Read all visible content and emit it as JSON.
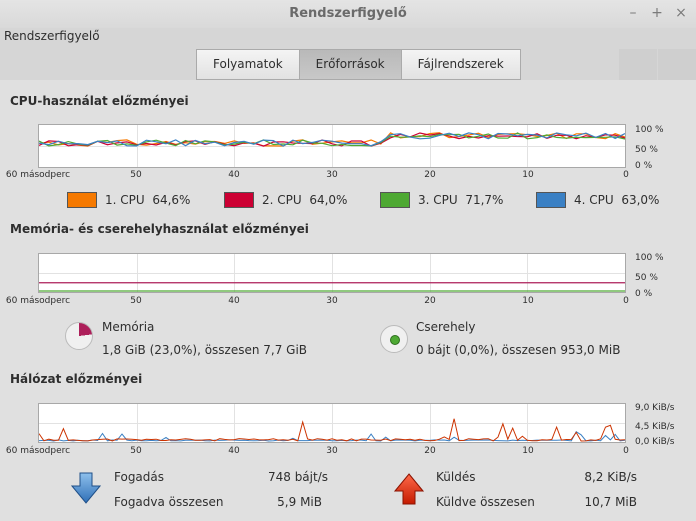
{
  "window": {
    "title": "Rendszerfigyelő",
    "min": "–",
    "max": "+",
    "close": "×"
  },
  "menu": {
    "app": "Rendszerfigyelő"
  },
  "tabs": [
    "Folyamatok",
    "Erőforrások",
    "Fájlrendszerek"
  ],
  "active_tab": 1,
  "cpu": {
    "title": "CPU-használat előzményei",
    "y_labels": [
      "100 %",
      "50 %",
      "0 %"
    ],
    "x_labels": [
      "60 másodperc",
      "50",
      "40",
      "30",
      "20",
      "10",
      "0"
    ],
    "legend": [
      {
        "name": "1. CPU",
        "value": "64,6%",
        "color": "#f57900"
      },
      {
        "name": "2. CPU",
        "value": "64,0%",
        "color": "#cc0033"
      },
      {
        "name": "3. CPU",
        "value": "71,7%",
        "color": "#4ea933"
      },
      {
        "name": "4. CPU",
        "value": "63,0%",
        "color": "#3a80c4"
      }
    ]
  },
  "memory": {
    "title": "Memória- és cserehelyhasználat előzményei",
    "y_labels": [
      "100 %",
      "50 %",
      "0 %"
    ],
    "x_labels": [
      "60 másodperc",
      "50",
      "40",
      "30",
      "20",
      "10",
      "0"
    ],
    "mem_label": "Memória",
    "mem_value": "1,8 GiB (23,0%), összesen 7,7 GiB",
    "mem_color": "#ad1f5a",
    "mem_percent": 23.0,
    "swap_label": "Cserehely",
    "swap_value": "0 bájt (0,0%), összesen 953,0 MiB",
    "swap_color": "#4ea933",
    "swap_percent": 0.0
  },
  "network": {
    "title": "Hálózat előzményei",
    "y_labels": [
      "9,0 KiB/s",
      "4,5 KiB/s",
      "0,0 KiB/s"
    ],
    "x_labels": [
      "60 másodperc",
      "50",
      "40",
      "30",
      "20",
      "10",
      "0"
    ],
    "recv_label": "Fogadás",
    "recv_value": "748 bájt/s",
    "recv_total_label": "Fogadva összesen",
    "recv_total_value": "5,9 MiB",
    "send_label": "Küldés",
    "send_value": "8,2 KiB/s",
    "send_total_label": "Küldve összesen",
    "send_total_value": "10,7 MiB",
    "recv_color": "#3a80c4",
    "send_color": "#cc3300"
  }
}
